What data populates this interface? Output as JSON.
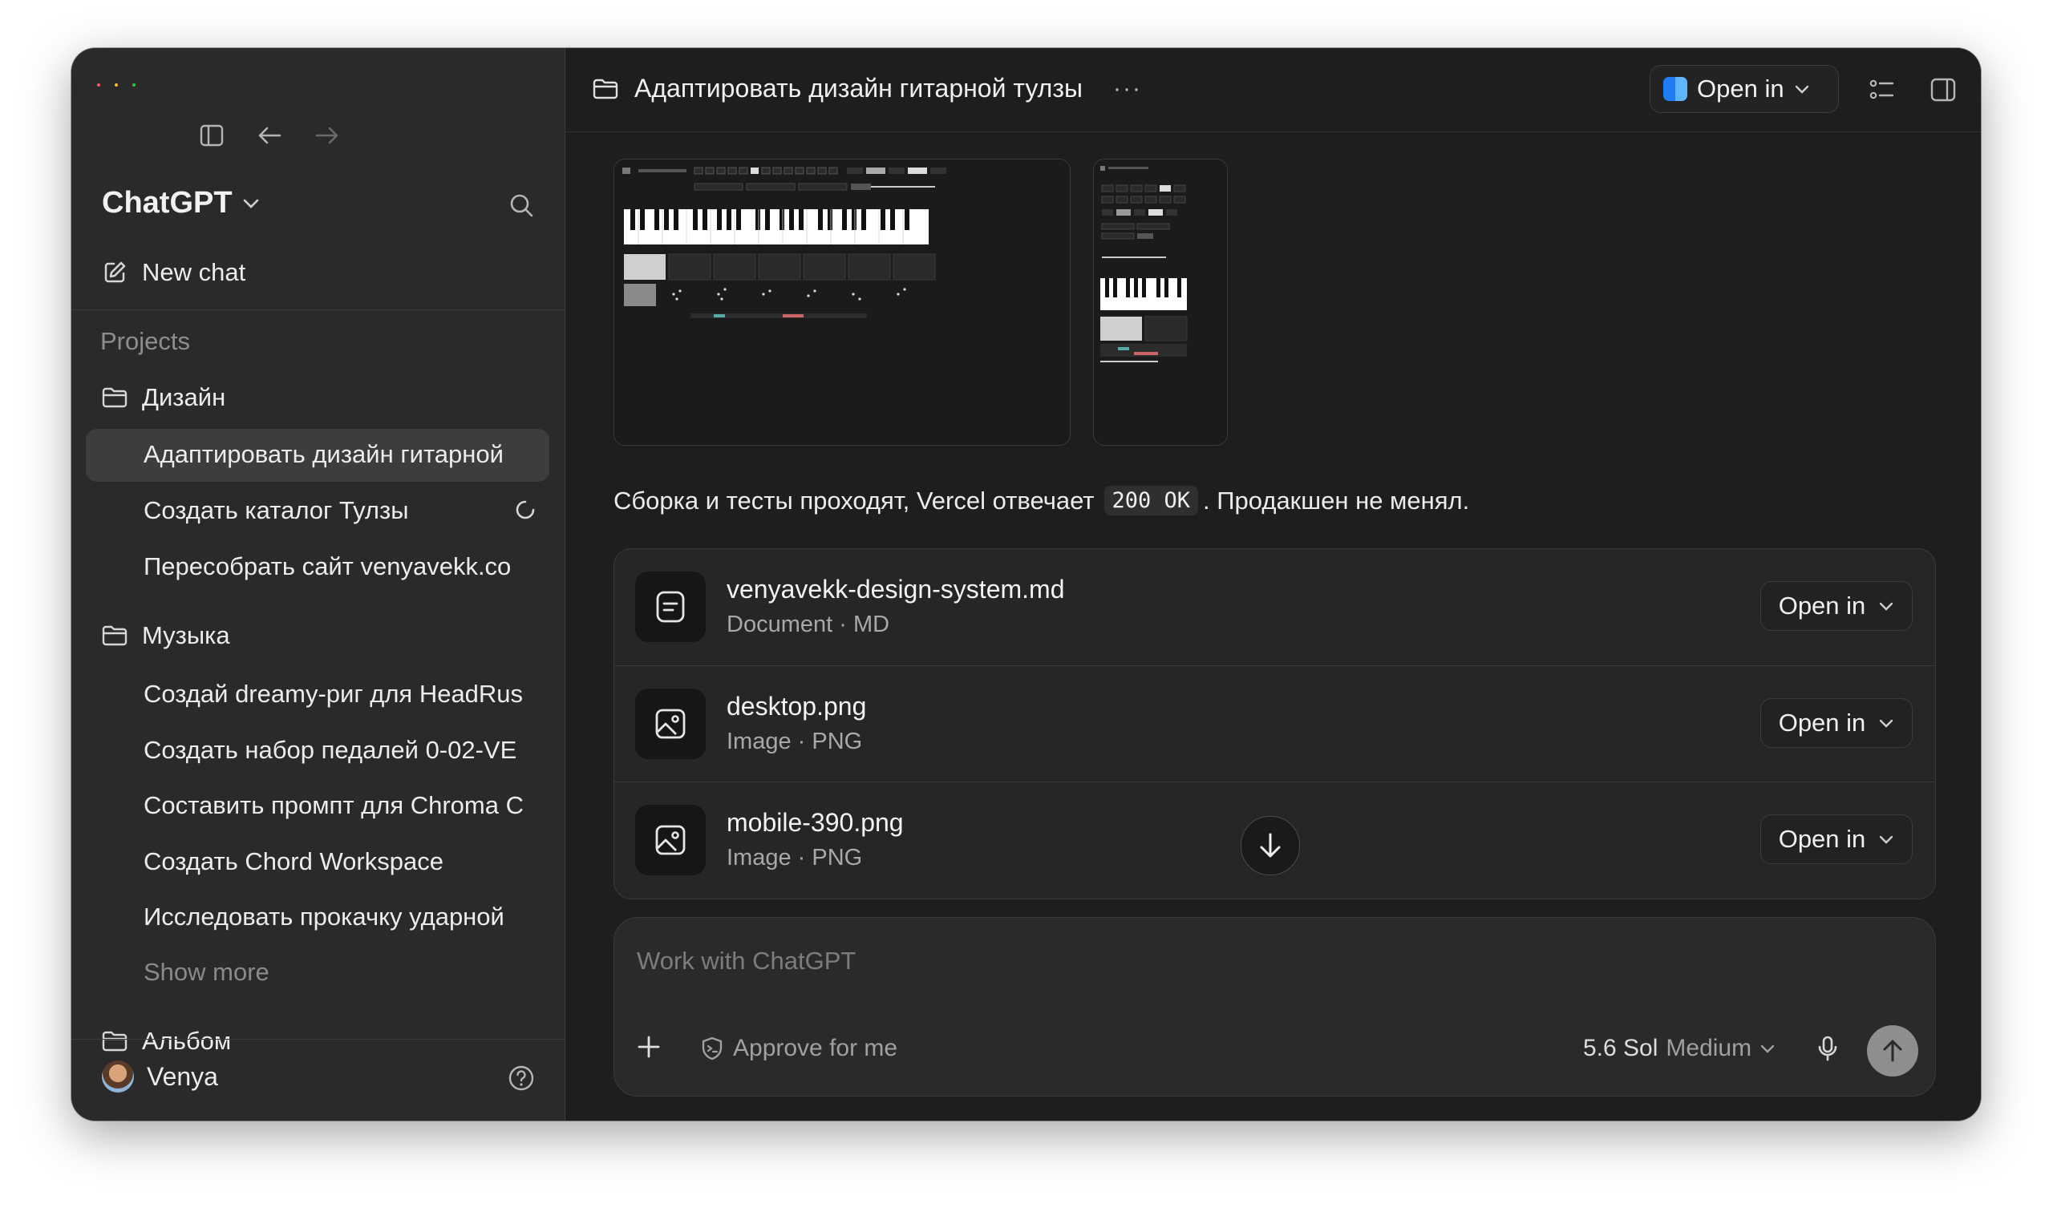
{
  "sidebar": {
    "brand": "ChatGPT",
    "new_chat": "New chat",
    "projects_label": "Projects",
    "projects": [
      {
        "name": "Дизайн",
        "chats": [
          "Адаптировать дизайн гитарной",
          "Создать каталог Тулзы",
          "Пересобрать сайт venyavekk.co"
        ]
      },
      {
        "name": "Музыка",
        "chats": [
          "Создай dreamy-риг для HeadRus",
          "Создать набор педалей 0-02-VE",
          "Составить промпт для Chroma C",
          "Создать Chord Workspace",
          "Исследовать прокачку ударной"
        ]
      },
      {
        "name": "Альбом",
        "chats": []
      }
    ],
    "show_more": "Show more",
    "user_name": "Venya"
  },
  "header": {
    "title": "Адаптировать дизайн гитарной тулзы",
    "more": "···",
    "open_in": "Open in"
  },
  "message": {
    "before_code": "Сборка и тесты проходят, Vercel отвечает",
    "code": "200 OK",
    "after_code": ". Продакшен не менял."
  },
  "files": [
    {
      "name": "venyavekk-design-system.md",
      "meta": "Document · MD",
      "icon": "document-icon",
      "open": "Open in"
    },
    {
      "name": "desktop.png",
      "meta": "Image · PNG",
      "icon": "image-icon",
      "open": "Open in"
    },
    {
      "name": "mobile-390.png",
      "meta": "Image · PNG",
      "icon": "image-icon",
      "open": "Open in"
    }
  ],
  "composer": {
    "placeholder": "Work with ChatGPT",
    "approve": "Approve for me",
    "model_version": "5.6 Sol",
    "model_level": "Medium"
  },
  "colors": {
    "sidebar_bg": "#2a2a2a",
    "main_bg": "#1e1e1e",
    "card_bg": "#262626",
    "accent_finder": "#1e7cf5"
  }
}
